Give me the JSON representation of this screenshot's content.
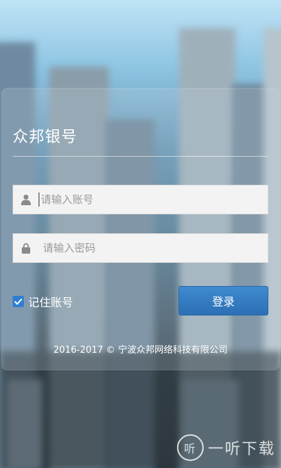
{
  "app": {
    "title": "众邦银号"
  },
  "login": {
    "username_placeholder": "请输入账号",
    "password_placeholder": "请输入密码",
    "remember_label": "记住账号",
    "remember_checked": true,
    "submit_label": "登录"
  },
  "footer": {
    "copyright": "2016-2017 © 宁波众邦网络科技有限公司"
  },
  "watermark": {
    "logo_text": "听",
    "text": "一听下载"
  },
  "colors": {
    "accent": "#2f7fd0",
    "button": "#3479c2"
  }
}
